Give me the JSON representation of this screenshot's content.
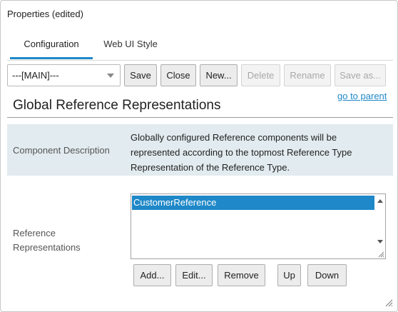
{
  "window": {
    "title": "Properties (edited)"
  },
  "tabs": [
    {
      "label": "Configuration",
      "active": true
    },
    {
      "label": "Web UI Style",
      "active": false
    }
  ],
  "toolbar": {
    "select_value": "---[MAIN]---",
    "save": "Save",
    "close": "Close",
    "new": "New...",
    "delete": "Delete",
    "rename": "Rename",
    "save_as": "Save as..."
  },
  "go_to_parent": "go to parent",
  "section": {
    "title": "Global Reference Representations",
    "description_label": "Component Description",
    "description_text": "Globally configured Reference components will be represented according to the topmost Reference Type Representation of the Reference Type.",
    "list_label": "Reference Representations",
    "items": [
      "CustomerReference"
    ],
    "selected_index": 0
  },
  "list_buttons": {
    "add": "Add...",
    "edit": "Edit...",
    "remove": "Remove",
    "up": "Up",
    "down": "Down"
  },
  "colors": {
    "accent": "#1e88c8",
    "description_band": "#e2ebef",
    "disabled_text": "#a8a8a8"
  },
  "icons": [
    "chevron-down-icon",
    "scroll-up-arrow-icon",
    "scroll-down-arrow-icon",
    "resize-grip-icon"
  ]
}
